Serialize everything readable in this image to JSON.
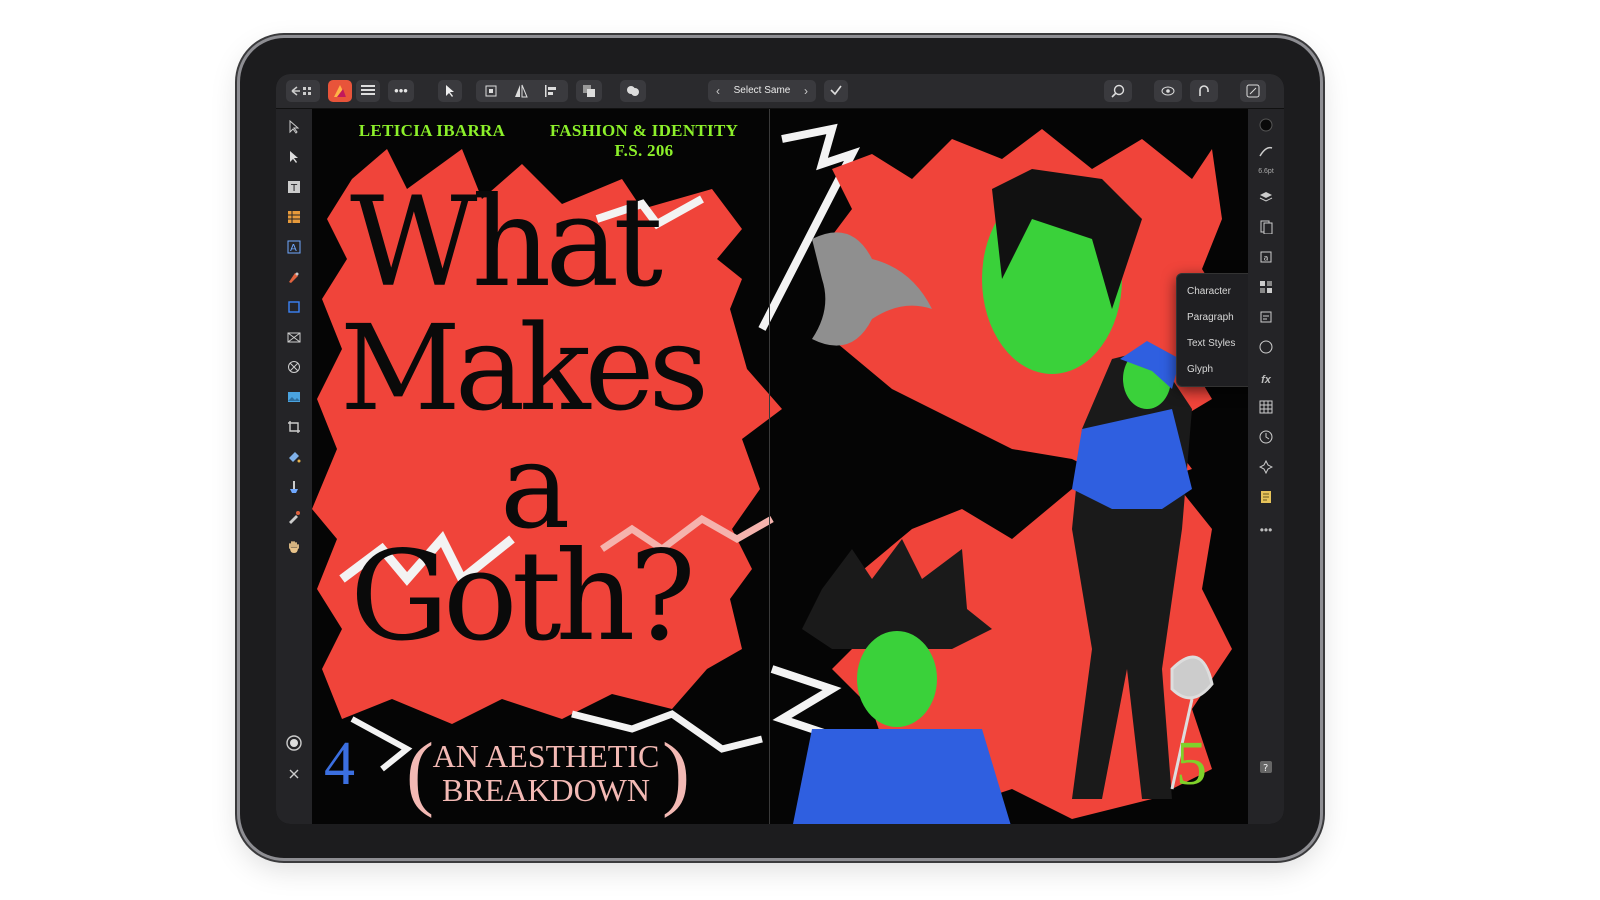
{
  "toolbar": {
    "select_same_label": "Select Same",
    "check_icon": "checkmark-icon",
    "more_label": "•••"
  },
  "popover": {
    "items": [
      "Character",
      "Paragraph",
      "Text Styles",
      "Glyph"
    ]
  },
  "document": {
    "author": "LETICIA IBARRA",
    "course_line1": "FASHION & IDENTITY",
    "course_line2": "F.S. 206",
    "title_lines": [
      "What",
      "Makes",
      "a",
      "Goth?"
    ],
    "subtitle_line1": "AN AESTHETIC",
    "subtitle_line2": "BREAKDOWN",
    "page_left": "4",
    "page_right": "5"
  },
  "colors": {
    "accent_red": "#f0443a",
    "green_text": "#8cf02a",
    "blue_page_number": "#3b6fe0",
    "green_page_number": "#7fd12a",
    "pink_subtitle": "#f3b9b4"
  },
  "right_panel": {
    "stroke_size_label": "6.6pt"
  }
}
